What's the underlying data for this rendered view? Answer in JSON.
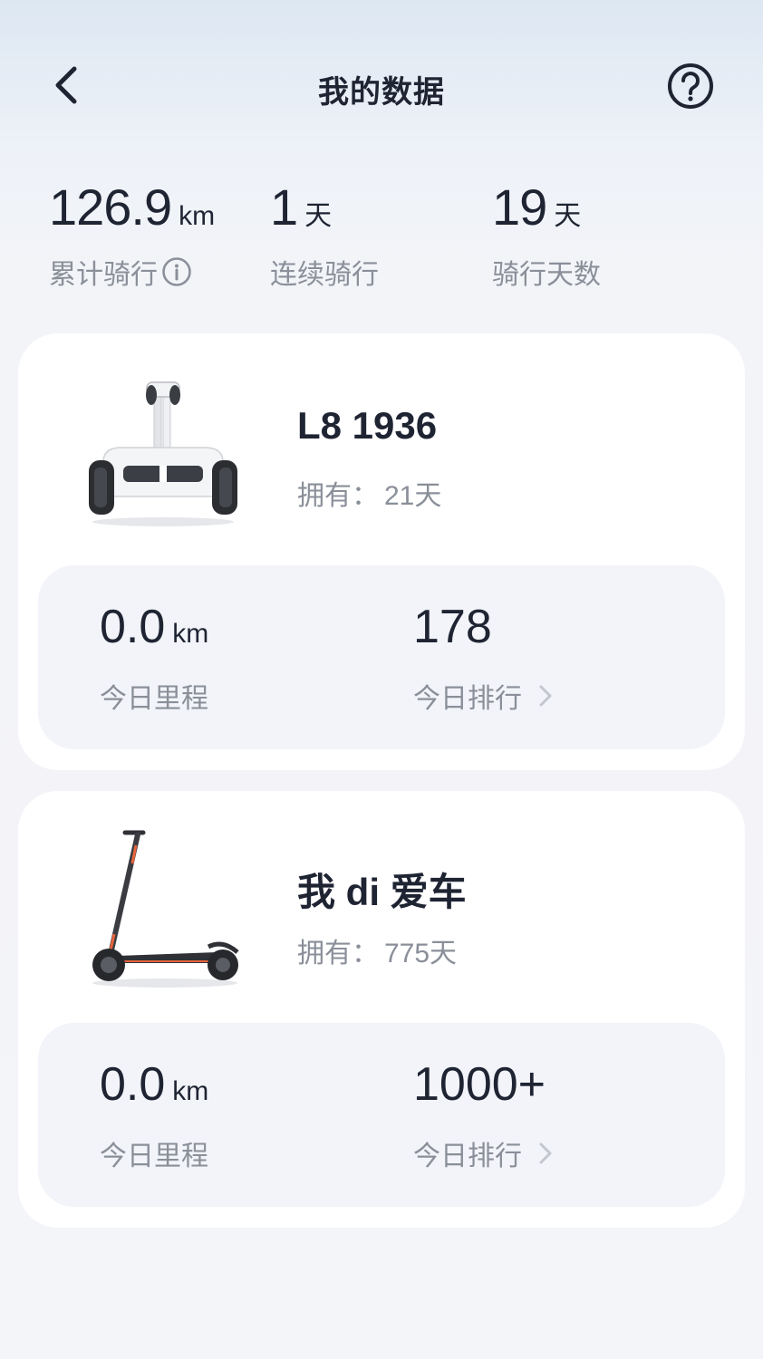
{
  "header": {
    "title": "我的数据",
    "back_icon": "chevron-left-icon",
    "help_icon": "question-circle-icon"
  },
  "summary": {
    "total_distance": {
      "value": "126.9",
      "unit": "km",
      "label": "累计骑行",
      "icon": "info-circle-icon"
    },
    "streak": {
      "value": "1",
      "unit": "天",
      "label": "连续骑行"
    },
    "ride_days": {
      "value": "19",
      "unit": "天",
      "label": "骑行天数"
    }
  },
  "vehicles": [
    {
      "name": "L8 1936",
      "owned_label": "拥有：",
      "owned_days": "21天",
      "image": "self-balancing-scooter-image",
      "today_distance": "0.0",
      "today_distance_unit": "km",
      "today_distance_label": "今日里程",
      "today_rank": "178",
      "today_rank_label": "今日排行"
    },
    {
      "name": "我 di 爱车",
      "owned_label": "拥有：",
      "owned_days": "775天",
      "image": "kick-scooter-image",
      "today_distance": "0.0",
      "today_distance_unit": "km",
      "today_distance_label": "今日里程",
      "today_rank": "1000+",
      "today_rank_label": "今日排行"
    }
  ],
  "colors": {
    "text_primary": "#1f2433",
    "text_secondary": "#8a8f99",
    "card_bg": "#ffffff",
    "inner_box_bg": "#f2f4f9",
    "accent_orange": "#e8643c"
  }
}
